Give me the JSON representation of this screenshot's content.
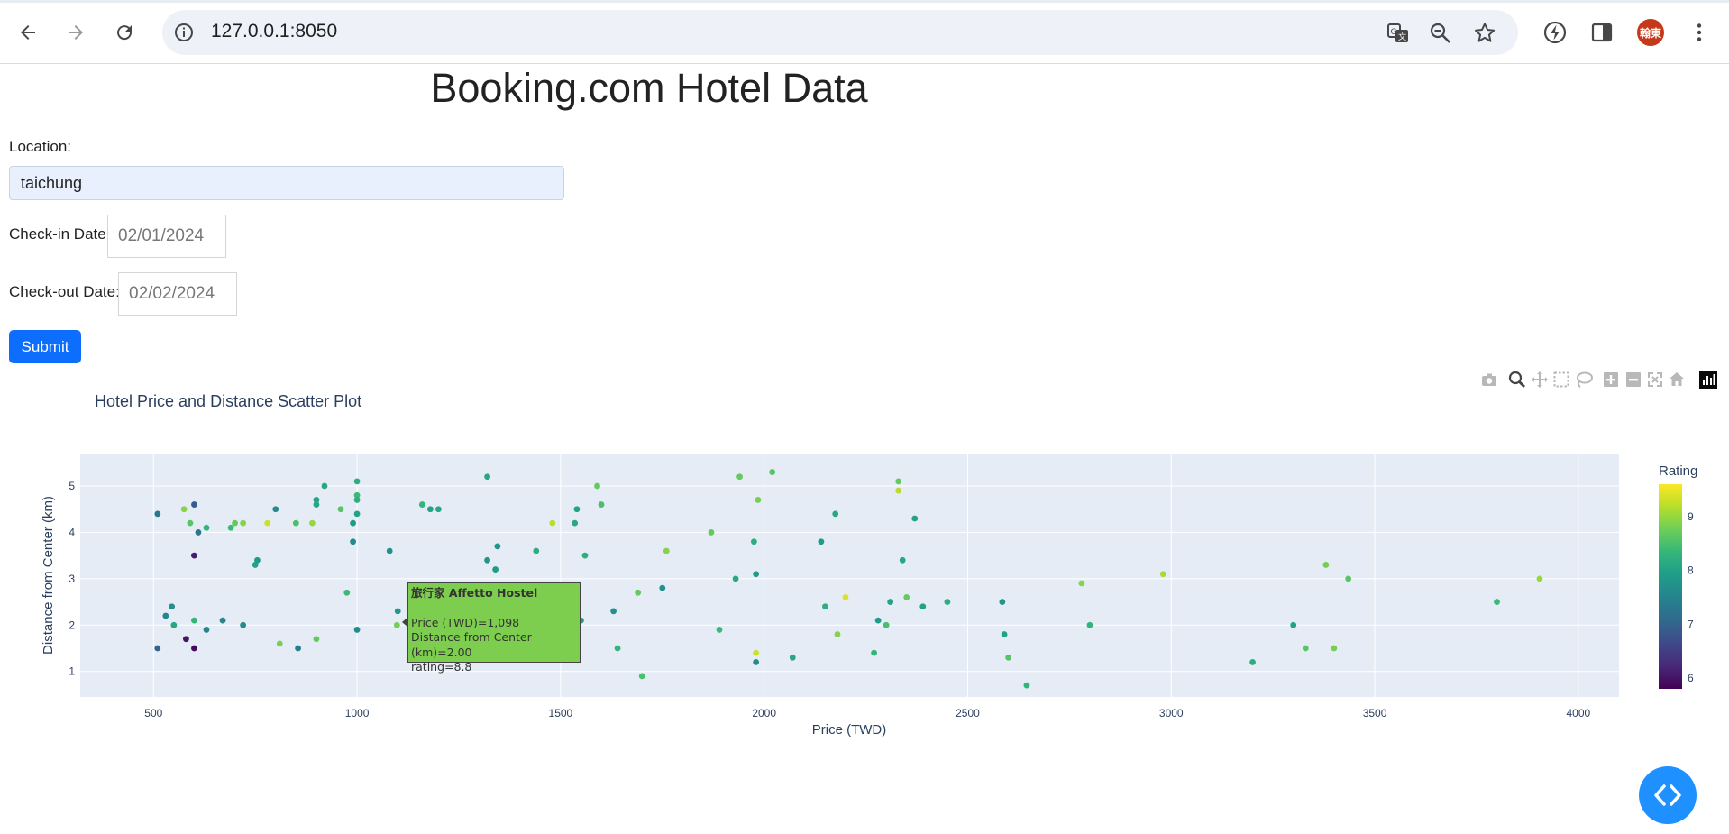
{
  "browser": {
    "url": "127.0.0.1:8050",
    "profile_initials": "翰東",
    "icons": [
      "back-icon",
      "forward-icon",
      "reload-icon",
      "site-info-icon",
      "translate-icon",
      "zoom-icon",
      "bookmark-star-icon",
      "performance-icon",
      "side-panel-icon",
      "menu-dots-icon"
    ]
  },
  "page": {
    "title": "Booking.com Hotel Data",
    "location_label": "Location:",
    "location_value": "taichung",
    "checkin_label": "Check-in Date:",
    "checkin_value": "02/01/2024",
    "checkout_label": "Check-out Date:",
    "checkout_value": "02/02/2024",
    "submit_label": "Submit"
  },
  "modebar_icons": [
    "camera-icon",
    "zoom-icon",
    "pan-icon",
    "box-select-icon",
    "lasso-icon",
    "zoom-in-icon",
    "zoom-out-icon",
    "autoscale-icon",
    "reset-axes-icon",
    "plotly-logo-icon"
  ],
  "hover": {
    "name": "旅行家 Affetto Hostel",
    "price_line": "Price (TWD)=1,098",
    "distance_line": "Distance from Center (km)=2.00",
    "rating_line": "rating=8.8",
    "color": "#7dcd4e"
  },
  "chart_data": {
    "type": "scatter",
    "title": "Hotel Price and Distance Scatter Plot",
    "xlabel": "Price (TWD)",
    "ylabel": "Distance from Center (km)",
    "xlim": [
      320,
      4100
    ],
    "ylim": [
      0.45,
      5.7
    ],
    "xticks": [
      500,
      1000,
      1500,
      2000,
      2500,
      3000,
      3500,
      4000
    ],
    "yticks": [
      1,
      2,
      3,
      4,
      5
    ],
    "grid": true,
    "colorbar": {
      "title": "Rating",
      "min": 5.8,
      "max": 9.6,
      "ticks": [
        6,
        7,
        8,
        9
      ],
      "colorscale": "viridis"
    },
    "points": [
      {
        "x": 510,
        "y": 4.4,
        "r": 7.3
      },
      {
        "x": 510,
        "y": 1.5,
        "r": 7.0
      },
      {
        "x": 530,
        "y": 2.2,
        "r": 7.5
      },
      {
        "x": 545,
        "y": 2.4,
        "r": 7.7
      },
      {
        "x": 550,
        "y": 2.0,
        "r": 8.1
      },
      {
        "x": 575,
        "y": 4.5,
        "r": 8.9
      },
      {
        "x": 580,
        "y": 1.7,
        "r": 6.0
      },
      {
        "x": 590,
        "y": 4.2,
        "r": 8.6
      },
      {
        "x": 600,
        "y": 4.6,
        "r": 6.9
      },
      {
        "x": 600,
        "y": 3.5,
        "r": 6.1
      },
      {
        "x": 600,
        "y": 2.1,
        "r": 8.3
      },
      {
        "x": 600,
        "y": 1.5,
        "r": 5.9
      },
      {
        "x": 610,
        "y": 4.0,
        "r": 7.3
      },
      {
        "x": 630,
        "y": 4.1,
        "r": 8.3
      },
      {
        "x": 630,
        "y": 1.9,
        "r": 7.5
      },
      {
        "x": 670,
        "y": 2.1,
        "r": 7.5
      },
      {
        "x": 690,
        "y": 4.1,
        "r": 8.4
      },
      {
        "x": 700,
        "y": 4.2,
        "r": 8.7
      },
      {
        "x": 720,
        "y": 4.2,
        "r": 8.9
      },
      {
        "x": 720,
        "y": 2.0,
        "r": 7.6
      },
      {
        "x": 750,
        "y": 3.3,
        "r": 8.0
      },
      {
        "x": 755,
        "y": 3.4,
        "r": 7.9
      },
      {
        "x": 780,
        "y": 4.2,
        "r": 9.3
      },
      {
        "x": 800,
        "y": 4.5,
        "r": 7.6
      },
      {
        "x": 810,
        "y": 1.6,
        "r": 8.8
      },
      {
        "x": 850,
        "y": 4.2,
        "r": 8.5
      },
      {
        "x": 855,
        "y": 1.5,
        "r": 7.4
      },
      {
        "x": 890,
        "y": 4.2,
        "r": 9.0
      },
      {
        "x": 900,
        "y": 4.7,
        "r": 8.0
      },
      {
        "x": 900,
        "y": 4.6,
        "r": 8.1
      },
      {
        "x": 900,
        "y": 1.7,
        "r": 8.7
      },
      {
        "x": 920,
        "y": 5.0,
        "r": 8.1
      },
      {
        "x": 960,
        "y": 4.5,
        "r": 8.6
      },
      {
        "x": 975,
        "y": 2.7,
        "r": 8.4
      },
      {
        "x": 990,
        "y": 4.2,
        "r": 7.9
      },
      {
        "x": 990,
        "y": 3.8,
        "r": 7.6
      },
      {
        "x": 1000,
        "y": 5.1,
        "r": 8.2
      },
      {
        "x": 1000,
        "y": 4.8,
        "r": 8.4
      },
      {
        "x": 1000,
        "y": 4.7,
        "r": 8.2
      },
      {
        "x": 1000,
        "y": 4.4,
        "r": 8.0
      },
      {
        "x": 1000,
        "y": 1.9,
        "r": 7.6
      },
      {
        "x": 1080,
        "y": 3.6,
        "r": 7.7
      },
      {
        "x": 1098,
        "y": 2.0,
        "r": 8.8
      },
      {
        "x": 1100,
        "y": 2.3,
        "r": 7.8
      },
      {
        "x": 1160,
        "y": 4.6,
        "r": 8.3
      },
      {
        "x": 1180,
        "y": 4.5,
        "r": 8.0
      },
      {
        "x": 1200,
        "y": 4.5,
        "r": 8.1
      },
      {
        "x": 1320,
        "y": 5.2,
        "r": 8.1
      },
      {
        "x": 1320,
        "y": 3.4,
        "r": 7.8
      },
      {
        "x": 1340,
        "y": 3.2,
        "r": 7.9
      },
      {
        "x": 1345,
        "y": 3.7,
        "r": 7.8
      },
      {
        "x": 1440,
        "y": 3.6,
        "r": 8.2
      },
      {
        "x": 1480,
        "y": 4.2,
        "r": 9.2
      },
      {
        "x": 1535,
        "y": 4.2,
        "r": 8.1
      },
      {
        "x": 1540,
        "y": 4.5,
        "r": 8.0
      },
      {
        "x": 1550,
        "y": 2.1,
        "r": 7.9
      },
      {
        "x": 1560,
        "y": 3.5,
        "r": 8.2
      },
      {
        "x": 1590,
        "y": 5.0,
        "r": 8.7
      },
      {
        "x": 1600,
        "y": 4.6,
        "r": 8.5
      },
      {
        "x": 1630,
        "y": 2.3,
        "r": 7.7
      },
      {
        "x": 1640,
        "y": 1.5,
        "r": 8.3
      },
      {
        "x": 1690,
        "y": 2.7,
        "r": 8.7
      },
      {
        "x": 1700,
        "y": 0.9,
        "r": 8.5
      },
      {
        "x": 1750,
        "y": 2.8,
        "r": 7.7
      },
      {
        "x": 1760,
        "y": 3.6,
        "r": 8.9
      },
      {
        "x": 1870,
        "y": 4.0,
        "r": 8.7
      },
      {
        "x": 1890,
        "y": 1.9,
        "r": 8.4
      },
      {
        "x": 1930,
        "y": 3.0,
        "r": 8.1
      },
      {
        "x": 1940,
        "y": 5.2,
        "r": 8.7
      },
      {
        "x": 1975,
        "y": 3.8,
        "r": 8.2
      },
      {
        "x": 1980,
        "y": 3.1,
        "r": 7.9
      },
      {
        "x": 1980,
        "y": 1.4,
        "r": 9.3
      },
      {
        "x": 1980,
        "y": 1.2,
        "r": 7.6
      },
      {
        "x": 1985,
        "y": 4.7,
        "r": 8.8
      },
      {
        "x": 2020,
        "y": 5.3,
        "r": 8.6
      },
      {
        "x": 2070,
        "y": 1.3,
        "r": 8.1
      },
      {
        "x": 2140,
        "y": 3.8,
        "r": 7.9
      },
      {
        "x": 2150,
        "y": 2.4,
        "r": 8.2
      },
      {
        "x": 2175,
        "y": 4.4,
        "r": 8.1
      },
      {
        "x": 2180,
        "y": 1.8,
        "r": 8.9
      },
      {
        "x": 2200,
        "y": 2.6,
        "r": 9.4
      },
      {
        "x": 2270,
        "y": 1.4,
        "r": 8.3
      },
      {
        "x": 2280,
        "y": 2.1,
        "r": 7.9
      },
      {
        "x": 2300,
        "y": 2.0,
        "r": 8.5
      },
      {
        "x": 2310,
        "y": 2.5,
        "r": 8.0
      },
      {
        "x": 2330,
        "y": 5.1,
        "r": 8.7
      },
      {
        "x": 2330,
        "y": 4.9,
        "r": 9.2
      },
      {
        "x": 2340,
        "y": 3.4,
        "r": 8.1
      },
      {
        "x": 2350,
        "y": 2.6,
        "r": 8.7
      },
      {
        "x": 2370,
        "y": 4.3,
        "r": 8.0
      },
      {
        "x": 2390,
        "y": 2.4,
        "r": 8.0
      },
      {
        "x": 2450,
        "y": 2.5,
        "r": 8.2
      },
      {
        "x": 2585,
        "y": 2.5,
        "r": 7.8
      },
      {
        "x": 2590,
        "y": 1.8,
        "r": 8.0
      },
      {
        "x": 2600,
        "y": 1.3,
        "r": 8.6
      },
      {
        "x": 2645,
        "y": 0.7,
        "r": 8.3
      },
      {
        "x": 2780,
        "y": 2.9,
        "r": 8.9
      },
      {
        "x": 2800,
        "y": 2.0,
        "r": 8.3
      },
      {
        "x": 2980,
        "y": 3.1,
        "r": 9.1
      },
      {
        "x": 3200,
        "y": 1.2,
        "r": 8.2
      },
      {
        "x": 3300,
        "y": 2.0,
        "r": 8.0
      },
      {
        "x": 3330,
        "y": 1.5,
        "r": 8.6
      },
      {
        "x": 3380,
        "y": 3.3,
        "r": 8.8
      },
      {
        "x": 3400,
        "y": 1.5,
        "r": 8.8
      },
      {
        "x": 3435,
        "y": 3.0,
        "r": 8.6
      },
      {
        "x": 3800,
        "y": 2.5,
        "r": 8.4
      },
      {
        "x": 3905,
        "y": 3.0,
        "r": 9.0
      }
    ]
  }
}
